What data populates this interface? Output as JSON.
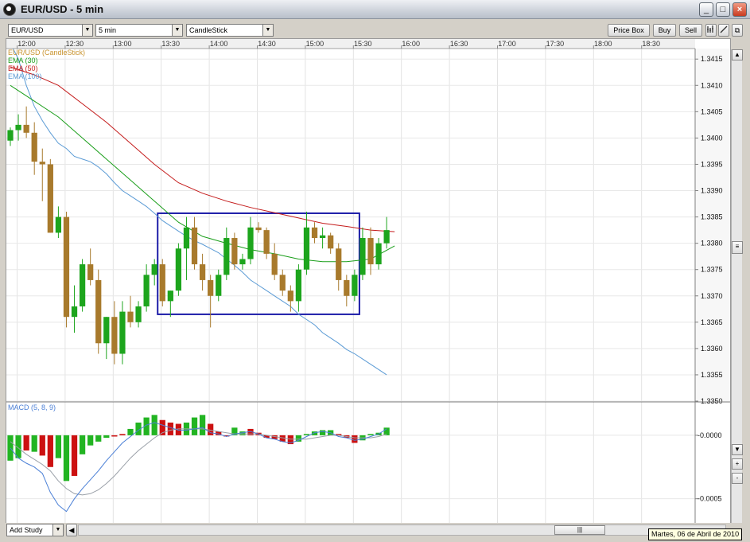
{
  "window": {
    "title": "EUR/USD - 5 min",
    "buttons": [
      "_",
      "□",
      "×"
    ],
    "restore_extra": "⧉"
  },
  "toolbar": {
    "symbol": "EUR/USD",
    "interval": "5 min",
    "chart_type": "CandleStick",
    "price_box_label": "Price Box",
    "buy_label": "Buy",
    "sell_label": "Sell",
    "tools": [
      "bar-chart-icon",
      "draw-line-icon"
    ]
  },
  "chart": {
    "time_labels": [
      "12:00",
      "12:30",
      "13:00",
      "13:30",
      "14:00",
      "14:30",
      "15:00",
      "15:30",
      "16:00",
      "16:30",
      "17:00",
      "17:30",
      "18:00",
      "18:30"
    ],
    "price_labels": [
      "1.3415",
      "1.3410",
      "1.3405",
      "1.3400",
      "1.3395",
      "1.3390",
      "1.3385",
      "1.3380",
      "1.3375",
      "1.3370",
      "1.3365",
      "1.3360",
      "1.3355",
      "1.3350"
    ],
    "legend": [
      {
        "text": "EUR/USD (CandleStick)",
        "color": "#c8922c"
      },
      {
        "text": "EMA (30)",
        "color": "#1a9e1a"
      },
      {
        "text": "EMA (50)",
        "color": "#c41b1b"
      },
      {
        "text": "EMA (100)",
        "color": "#5b9bd5"
      }
    ],
    "macd_label": "MACD (5, 8, 9)",
    "macd_labels": [
      "-0.0000",
      "-0.0005"
    ],
    "colors": {
      "up": "#1da51d",
      "down": "#a87a2c",
      "ema30": "#1a9e1a",
      "ema50": "#c41b1b",
      "ema100": "#5b9bd5",
      "box": "#1b1ba8",
      "macd_up": "#22b422",
      "macd_down": "#cc1111",
      "macd_line": "#4a7fd6",
      "signal_line": "#9aa0a8"
    }
  },
  "chart_data": {
    "type": "candlestick",
    "title": "EUR/USD - 5 min",
    "interval_minutes": 5,
    "x_start": "11:55",
    "ylim": [
      1.335,
      1.3417
    ],
    "candles": [
      {
        "o": 1.33995,
        "h": 1.3402,
        "l": 1.33985,
        "c": 1.34015
      },
      {
        "o": 1.34015,
        "h": 1.34045,
        "l": 1.33995,
        "c": 1.34025
      },
      {
        "o": 1.34025,
        "h": 1.3406,
        "l": 1.34,
        "c": 1.3401
      },
      {
        "o": 1.3401,
        "h": 1.3403,
        "l": 1.3393,
        "c": 1.33955
      },
      {
        "o": 1.33955,
        "h": 1.3398,
        "l": 1.3388,
        "c": 1.3395
      },
      {
        "o": 1.3395,
        "h": 1.3396,
        "l": 1.3382,
        "c": 1.3382
      },
      {
        "o": 1.3382,
        "h": 1.3387,
        "l": 1.3381,
        "c": 1.3385
      },
      {
        "o": 1.3385,
        "h": 1.3386,
        "l": 1.3364,
        "c": 1.3366
      },
      {
        "o": 1.3366,
        "h": 1.3372,
        "l": 1.3363,
        "c": 1.3368
      },
      {
        "o": 1.3368,
        "h": 1.3377,
        "l": 1.3367,
        "c": 1.3376
      },
      {
        "o": 1.3376,
        "h": 1.3379,
        "l": 1.3372,
        "c": 1.3373
      },
      {
        "o": 1.3373,
        "h": 1.3375,
        "l": 1.3359,
        "c": 1.3361
      },
      {
        "o": 1.3361,
        "h": 1.3366,
        "l": 1.3358,
        "c": 1.3366
      },
      {
        "o": 1.3366,
        "h": 1.3369,
        "l": 1.3357,
        "c": 1.3359
      },
      {
        "o": 1.3359,
        "h": 1.3369,
        "l": 1.3357,
        "c": 1.3367
      },
      {
        "o": 1.3367,
        "h": 1.337,
        "l": 1.3364,
        "c": 1.3365
      },
      {
        "o": 1.3365,
        "h": 1.3369,
        "l": 1.3364,
        "c": 1.3368
      },
      {
        "o": 1.3368,
        "h": 1.3376,
        "l": 1.3367,
        "c": 1.3374
      },
      {
        "o": 1.3374,
        "h": 1.3377,
        "l": 1.3372,
        "c": 1.3376
      },
      {
        "o": 1.3376,
        "h": 1.3377,
        "l": 1.3368,
        "c": 1.3369
      },
      {
        "o": 1.3369,
        "h": 1.3371,
        "l": 1.3366,
        "c": 1.3371
      },
      {
        "o": 1.3371,
        "h": 1.338,
        "l": 1.337,
        "c": 1.3379
      },
      {
        "o": 1.3379,
        "h": 1.3385,
        "l": 1.3373,
        "c": 1.3383
      },
      {
        "o": 1.3383,
        "h": 1.3385,
        "l": 1.3375,
        "c": 1.3376
      },
      {
        "o": 1.3376,
        "h": 1.3378,
        "l": 1.3371,
        "c": 1.3373
      },
      {
        "o": 1.3373,
        "h": 1.3374,
        "l": 1.3364,
        "c": 1.337
      },
      {
        "o": 1.337,
        "h": 1.3375,
        "l": 1.3369,
        "c": 1.3374
      },
      {
        "o": 1.3374,
        "h": 1.3383,
        "l": 1.3373,
        "c": 1.3381
      },
      {
        "o": 1.3381,
        "h": 1.3382,
        "l": 1.3375,
        "c": 1.3376
      },
      {
        "o": 1.3376,
        "h": 1.3378,
        "l": 1.3375,
        "c": 1.3377
      },
      {
        "o": 1.3377,
        "h": 1.3385,
        "l": 1.3376,
        "c": 1.3383
      },
      {
        "o": 1.3383,
        "h": 1.3384,
        "l": 1.3382,
        "c": 1.33825
      },
      {
        "o": 1.33825,
        "h": 1.3383,
        "l": 1.3377,
        "c": 1.3378
      },
      {
        "o": 1.3378,
        "h": 1.338,
        "l": 1.3373,
        "c": 1.3374
      },
      {
        "o": 1.3374,
        "h": 1.3375,
        "l": 1.337,
        "c": 1.3371
      },
      {
        "o": 1.3371,
        "h": 1.3372,
        "l": 1.3367,
        "c": 1.3369
      },
      {
        "o": 1.3369,
        "h": 1.3376,
        "l": 1.3367,
        "c": 1.3375
      },
      {
        "o": 1.3375,
        "h": 1.3386,
        "l": 1.3374,
        "c": 1.3383
      },
      {
        "o": 1.3383,
        "h": 1.3384,
        "l": 1.338,
        "c": 1.3381
      },
      {
        "o": 1.3381,
        "h": 1.3383,
        "l": 1.3379,
        "c": 1.33815
      },
      {
        "o": 1.33815,
        "h": 1.3382,
        "l": 1.3378,
        "c": 1.3379
      },
      {
        "o": 1.3379,
        "h": 1.338,
        "l": 1.3371,
        "c": 1.3373
      },
      {
        "o": 1.3373,
        "h": 1.3374,
        "l": 1.3368,
        "c": 1.337
      },
      {
        "o": 1.337,
        "h": 1.3375,
        "l": 1.3369,
        "c": 1.3374
      },
      {
        "o": 1.3374,
        "h": 1.3383,
        "l": 1.3373,
        "c": 1.3381
      },
      {
        "o": 1.3381,
        "h": 1.3383,
        "l": 1.3374,
        "c": 1.3376
      },
      {
        "o": 1.3376,
        "h": 1.3381,
        "l": 1.3375,
        "c": 1.338
      },
      {
        "o": 1.338,
        "h": 1.3385,
        "l": 1.3379,
        "c": 1.33825
      }
    ],
    "ema30": [
      1.341,
      1.3407,
      1.3404,
      1.34,
      1.3396,
      1.3392,
      1.3388,
      1.3384,
      1.33813,
      1.338,
      1.33788,
      1.3378,
      1.3377,
      1.33765,
      1.33765,
      1.3377,
      1.33795
    ],
    "ema50": [
      1.34135,
      1.3412,
      1.341,
      1.34065,
      1.3403,
      1.3399,
      1.3395,
      1.33915,
      1.33895,
      1.3388,
      1.33868,
      1.33858,
      1.33848,
      1.33838,
      1.33832,
      1.33825,
      1.33822
    ],
    "ema100": [
      1.3418,
      1.3415,
      1.341,
      1.3406,
      1.34033,
      1.3401,
      1.3399,
      1.3398,
      1.33965,
      1.3396,
      1.33955,
      1.33945,
      1.33932,
      1.33915,
      1.339,
      1.3389,
      1.3388,
      1.3387,
      1.33857,
      1.33843,
      1.33833,
      1.33823,
      1.33813,
      1.33805,
      1.33798,
      1.3379,
      1.33782,
      1.3377,
      1.33758,
      1.33745,
      1.3373,
      1.3372,
      1.3371,
      1.337,
      1.3369,
      1.3368,
      1.33665,
      1.33655,
      1.33645,
      1.3363,
      1.3362,
      1.3361,
      1.33598,
      1.3359,
      1.3358,
      1.3357,
      1.3356,
      1.3355
    ],
    "ema100_note": "",
    "ema_index_step": 3,
    "macd_ylim": [
      -0.00069,
      0.00025
    ],
    "macd_hist": [
      -0.0002,
      -0.00018,
      -0.00012,
      -0.00013,
      -0.00016,
      -0.00025,
      -0.00018,
      -0.00036,
      -0.00032,
      -0.00015,
      -8e-05,
      -5e-05,
      -2e-05,
      -1e-05,
      1e-05,
      5e-05,
      0.0001,
      0.00014,
      0.00016,
      0.00012,
      0.0001,
      9e-05,
      0.0001,
      0.00014,
      0.00016,
      9e-05,
      3e-05,
      -1e-05,
      6e-05,
      3e-05,
      5e-05,
      2e-05,
      -2e-05,
      -3e-05,
      -5e-05,
      -7e-05,
      -5e-05,
      1e-05,
      3e-05,
      4e-05,
      4e-05,
      1e-05,
      -2e-05,
      -6e-05,
      -4e-05,
      1e-05,
      2e-05,
      6e-05
    ],
    "macd_hist_colors": [
      "up",
      "up",
      "down",
      "up",
      "down",
      "down",
      "up",
      "up",
      "down",
      "up",
      "up",
      "up",
      "up",
      "down",
      "down",
      "up",
      "up",
      "up",
      "up",
      "down",
      "down",
      "down",
      "up",
      "up",
      "up",
      "down",
      "down",
      "down",
      "up",
      "up",
      "down",
      "down",
      "down",
      "down",
      "down",
      "down",
      "up",
      "up",
      "up",
      "up",
      "up",
      "down",
      "down",
      "down",
      "up",
      "up",
      "up",
      "up"
    ],
    "macd_line": [
      -0.0001,
      -0.00018,
      -0.00022,
      -0.00025,
      -0.0003,
      -0.00045,
      -0.00055,
      -0.0006,
      -0.0005,
      -0.00042,
      -0.00035,
      -0.00028,
      -0.0002,
      -0.00013,
      -6e-05,
      -1e-05,
      4e-05,
      8e-05,
      0.0001,
      8e-05,
      6e-05,
      4e-05,
      4e-05,
      5e-05,
      6e-05,
      2e-05,
      1e-05,
      -1e-05,
      1e-05,
      2e-05,
      3e-05,
      1e-05,
      -2e-05,
      -3e-05,
      -5e-05,
      -6e-05,
      -4e-05,
      -1e-05,
      2e-05,
      3e-05,
      2e-05,
      -1e-05,
      -2e-05,
      -4e-05,
      -3e-05,
      -1e-05,
      1e-05,
      5e-05
    ],
    "signal_line": [
      -5e-05,
      -0.0001,
      -0.00015,
      -0.00019,
      -0.00023,
      -0.00028,
      -0.00036,
      -0.00042,
      -0.00046,
      -0.00047,
      -0.00046,
      -0.00043,
      -0.00038,
      -0.00032,
      -0.00025,
      -0.00018,
      -0.00012,
      -7e-05,
      -2e-05,
      2e-05,
      4e-05,
      5e-05,
      5e-05,
      5e-05,
      5e-05,
      4e-05,
      3e-05,
      2e-05,
      1e-05,
      1e-05,
      1e-05,
      1e-05,
      0.0,
      -1e-05,
      -2e-05,
      -3e-05,
      -3e-05,
      -3e-05,
      -2e-05,
      -1e-05,
      0.0,
      0.0,
      -1e-05,
      -2e-05,
      -2e-05,
      -2e-05,
      -1e-05,
      1e-05
    ],
    "highlight_box": {
      "from_candle": 19,
      "to_candle": 43,
      "price_low": 1.33665,
      "price_high": 1.33857
    }
  },
  "bottom": {
    "add_study_label": "Add Study",
    "status_text": "Martes, 06 de Abril de 2010"
  }
}
